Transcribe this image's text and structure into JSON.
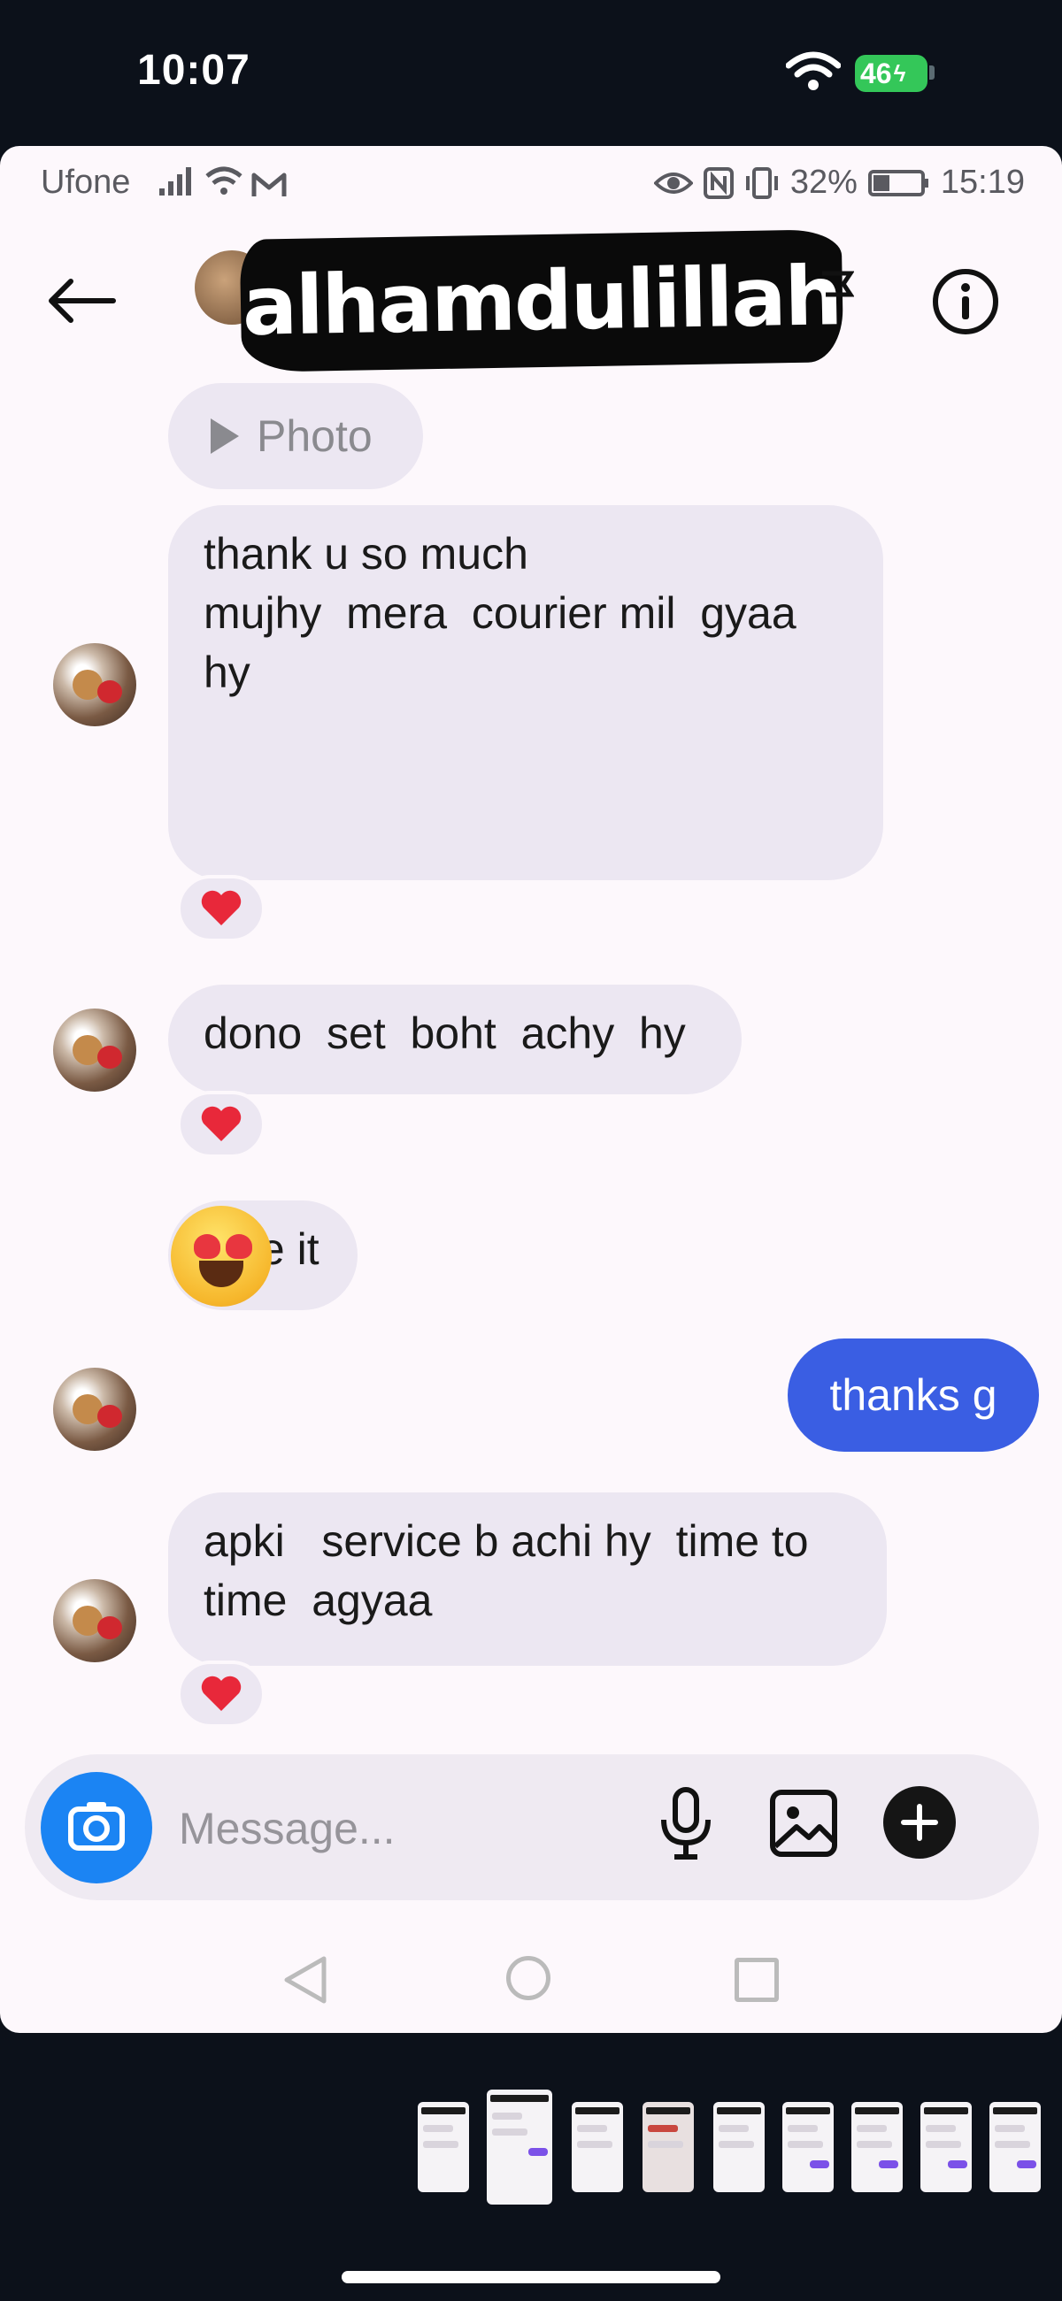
{
  "ios_status": {
    "time": "10:07",
    "battery": "46"
  },
  "android_status": {
    "carrier": "Ufone",
    "battery_pct": "32%",
    "time": "15:19"
  },
  "header": {
    "contact_name": "alhamdulillah"
  },
  "messages": {
    "photo_label": "Photo",
    "m1": "thank u so much\nmujhy  mera  courier mil  gyaa\nhy",
    "m2": "dono  set  boht  achy  hy",
    "m3": "love it",
    "m4_emoji": "smiling-face-with-heart-eyes",
    "sent": "thanks g",
    "m5": "apki   service b achi hy  time to\ntime  agyaa",
    "reaction": "red-heart"
  },
  "composer": {
    "placeholder": "Message..."
  },
  "colors": {
    "sent_bubble": "#3a5ee3",
    "received_bubble": "#ece7f2",
    "camera_button": "#1b84f3",
    "accent_bg": "#fdf8fc"
  }
}
